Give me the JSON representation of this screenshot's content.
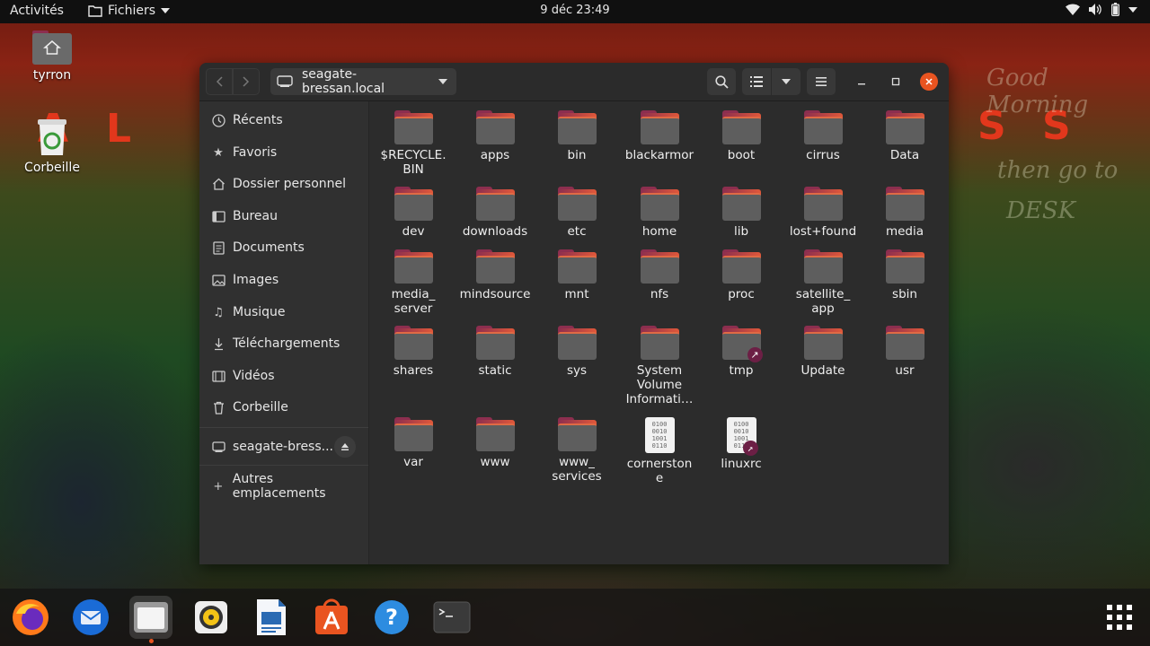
{
  "topbar": {
    "activities": "Activités",
    "app_menu": "Fichiers",
    "clock": "9 déc  23:49",
    "tray_icons": [
      "wifi-icon",
      "volume-icon",
      "battery-icon",
      "system-menu-chevron-icon"
    ]
  },
  "desktop": {
    "icons": [
      {
        "label": "tyrron",
        "icon": "home-folder-icon"
      },
      {
        "label": "Corbeille",
        "icon": "trash-icon"
      }
    ]
  },
  "window": {
    "location": "seagate-bressan.local",
    "accent_color": "#e95420",
    "sidebar": {
      "items": [
        {
          "label": "Récents",
          "icon": "clock-icon"
        },
        {
          "label": "Favoris",
          "icon": "star-icon"
        },
        {
          "label": "Dossier personnel",
          "icon": "home-icon"
        },
        {
          "label": "Bureau",
          "icon": "desktop-icon"
        },
        {
          "label": "Documents",
          "icon": "document-icon"
        },
        {
          "label": "Images",
          "icon": "image-icon"
        },
        {
          "label": "Musique",
          "icon": "music-icon"
        },
        {
          "label": "Téléchargements",
          "icon": "download-icon"
        },
        {
          "label": "Vidéos",
          "icon": "video-icon"
        },
        {
          "label": "Corbeille",
          "icon": "trash-icon"
        }
      ],
      "mounts": [
        {
          "label": "seagate-bress...",
          "icon": "network-drive-icon"
        }
      ],
      "other": {
        "label": "Autres emplacements",
        "icon": "plus-icon"
      }
    },
    "files": [
      {
        "name": "$RECYCLE.\nBIN",
        "type": "folder"
      },
      {
        "name": "apps",
        "type": "folder"
      },
      {
        "name": "bin",
        "type": "folder"
      },
      {
        "name": "blackarmor",
        "type": "folder"
      },
      {
        "name": "boot",
        "type": "folder"
      },
      {
        "name": "cirrus",
        "type": "folder"
      },
      {
        "name": "Data",
        "type": "folder"
      },
      {
        "name": "dev",
        "type": "folder"
      },
      {
        "name": "downloads",
        "type": "folder"
      },
      {
        "name": "etc",
        "type": "folder"
      },
      {
        "name": "home",
        "type": "folder"
      },
      {
        "name": "lib",
        "type": "folder"
      },
      {
        "name": "lost+found",
        "type": "folder"
      },
      {
        "name": "media",
        "type": "folder"
      },
      {
        "name": "media_\nserver",
        "type": "folder"
      },
      {
        "name": "mindsource",
        "type": "folder"
      },
      {
        "name": "mnt",
        "type": "folder"
      },
      {
        "name": "nfs",
        "type": "folder"
      },
      {
        "name": "proc",
        "type": "folder"
      },
      {
        "name": "satellite_\napp",
        "type": "folder"
      },
      {
        "name": "sbin",
        "type": "folder"
      },
      {
        "name": "shares",
        "type": "folder"
      },
      {
        "name": "static",
        "type": "folder"
      },
      {
        "name": "sys",
        "type": "folder"
      },
      {
        "name": "System\nVolume\nInformati…",
        "type": "folder"
      },
      {
        "name": "tmp",
        "type": "folder-link"
      },
      {
        "name": "Update",
        "type": "folder"
      },
      {
        "name": "usr",
        "type": "folder"
      },
      {
        "name": "var",
        "type": "folder"
      },
      {
        "name": "www",
        "type": "folder"
      },
      {
        "name": "www_\nservices",
        "type": "folder"
      },
      {
        "name": "cornerston\ne",
        "type": "binary"
      },
      {
        "name": "linuxrc",
        "type": "binary-link"
      }
    ]
  },
  "dock": {
    "apps": [
      {
        "name": "Firefox",
        "icon": "firefox-icon"
      },
      {
        "name": "Thunderbird",
        "icon": "thunderbird-icon"
      },
      {
        "name": "Fichiers",
        "icon": "files-icon",
        "running": true
      },
      {
        "name": "Rhythmbox",
        "icon": "rhythmbox-icon"
      },
      {
        "name": "LibreOffice Writer",
        "icon": "writer-icon"
      },
      {
        "name": "Ubuntu Software",
        "icon": "software-icon"
      },
      {
        "name": "Aide",
        "icon": "help-icon"
      },
      {
        "name": "Terminal",
        "icon": "terminal-icon"
      }
    ],
    "grid_button": "show-applications-icon"
  }
}
